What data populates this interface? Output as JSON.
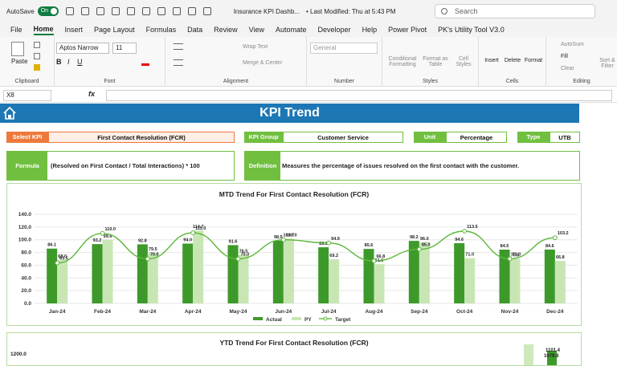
{
  "titlebar": {
    "autosave": "AutoSave",
    "toggle": "On",
    "document": "Insurance KPI Dashb...",
    "modified": "• Last Modified: Thu at 5:43 PM",
    "search": "Search"
  },
  "menu": [
    "File",
    "Home",
    "Insert",
    "Page Layout",
    "Formulas",
    "Data",
    "Review",
    "View",
    "Automate",
    "Developer",
    "Help",
    "Power Pivot",
    "PK's Utility Tool V3.0"
  ],
  "ribbon": {
    "paste": "Paste",
    "clipboard": "Clipboard",
    "font_name": "Aptos Narrow",
    "font_size": "11",
    "font": "Font",
    "wrap": "Wrap Text",
    "merge": "Merge & Center",
    "alignment": "Alignment",
    "number_format": "General",
    "number": "Number",
    "cond": "Conditional Formatting",
    "format_as": "Format as Table",
    "cell_styles": "Cell Styles",
    "styles": "Styles",
    "insert": "Insert",
    "delete": "Delete",
    "format": "Format",
    "cells": "Cells",
    "autosum": "AutoSum",
    "fill": "Fill",
    "clear": "Clear",
    "sort": "Sort & Filter",
    "editing": "Editing"
  },
  "formula_bar": {
    "cell": "X8",
    "fx": "fx"
  },
  "dashboard": {
    "title": "KPI Trend",
    "select_kpi_label": "Select KPI",
    "select_kpi_value": "First Contact Resolution (FCR)",
    "kpi_group_label": "KPI Group",
    "kpi_group_value": "Customer Service",
    "unit_label": "Unit",
    "unit_value": "Percentage",
    "type_label": "Type",
    "type_value": "UTB",
    "formula_label": "Formula",
    "formula_value": "(Resolved on First Contact / Total Interactions) * 100",
    "definition_label": "Definition",
    "definition_value": "Measures the percentage of issues resolved on the first contact with the customer."
  },
  "colors": {
    "actual": "#3d9a2a",
    "py": "#c8e6b4",
    "target": "#5cb83c",
    "banner": "#1d77b5",
    "accent": "#70bf3f",
    "orange": "#ed7a3c"
  },
  "chart_data": [
    {
      "type": "bar",
      "title": "MTD Trend For First Contact Resolution (FCR)",
      "categories": [
        "Jan-24",
        "Feb-24",
        "Mar-24",
        "Apr-24",
        "May-24",
        "Jun-24",
        "Jul-24",
        "Aug-24",
        "Sep-24",
        "Oct-24",
        "Nov-24",
        "Dec-24"
      ],
      "ylim": [
        0,
        140
      ],
      "yticks": [
        "0.0",
        "20.0",
        "40.0",
        "60.0",
        "80.0",
        "100.0",
        "120.0",
        "140.0"
      ],
      "series": [
        {
          "name": "Actual",
          "values": [
            86.1,
            93.2,
            92.8,
            94.0,
            91.6,
            98.5,
            88.2,
            85.6,
            98.2,
            94.6,
            84.5,
            84.6
          ]
        },
        {
          "name": "PY",
          "values": [
            68.0,
            99.9,
            79.5,
            114.7,
            76.5,
            101.7,
            69.2,
            61.6,
            96.0,
            71.0,
            70.0,
            66.8
          ]
        },
        {
          "name": "Target",
          "values": [
            63.5,
            110.0,
            70.0,
            111.0,
            70.0,
            100.0,
            94.9,
            66.8,
            85.0,
            113.5,
            70.0,
            103.2
          ]
        }
      ]
    },
    {
      "type": "bar",
      "title": "YTD Trend For First Contact Resolution (FCR)",
      "yticks": [
        "1200.0"
      ],
      "visible_labels": [
        "1101.4",
        "1079.8"
      ]
    }
  ]
}
